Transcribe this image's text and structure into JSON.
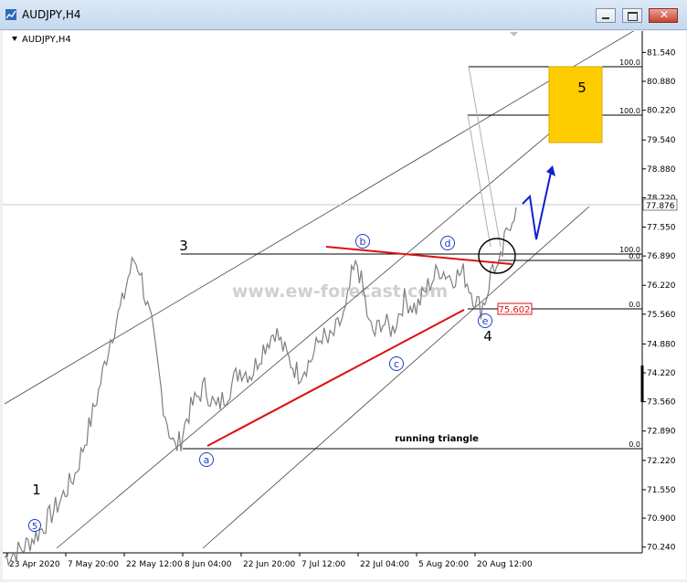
{
  "window": {
    "title": "AUDJPY,H4",
    "buttons": [
      "minimize",
      "restore",
      "close"
    ]
  },
  "chart_label": "AUDJPY,H4",
  "watermark": "www.ew-forecast.com",
  "chart_data": {
    "type": "line",
    "symbol": "AUDJPY",
    "timeframe": "H4",
    "ylim": [
      70.15,
      81.84
    ],
    "y_ticks": [
      "81.540",
      "80.880",
      "80.220",
      "79.540",
      "78.880",
      "78.220",
      "77.550",
      "76.890",
      "76.220",
      "75.560",
      "74.880",
      "74.220",
      "73.560",
      "72.890",
      "72.220",
      "71.550",
      "70.900",
      "70.240"
    ],
    "x_ticks": [
      "23 Apr 2020",
      "7 May 20:00",
      "22 May 12:00",
      "8 Jun 04:00",
      "22 Jun 20:00",
      "7 Jul 12:00",
      "22 Jul 04:00",
      "5 Aug 20:00",
      "20 Aug 12:00"
    ],
    "current_price": "77.876",
    "price_path": [
      [
        0,
        70.0
      ],
      [
        3,
        70.2
      ],
      [
        6,
        70.6
      ],
      [
        9,
        71.2
      ],
      [
        12,
        71.9
      ],
      [
        14,
        72.8
      ],
      [
        16,
        73.8
      ],
      [
        18,
        75.0
      ],
      [
        20,
        75.8
      ],
      [
        21,
        76.4
      ],
      [
        22,
        76.8
      ],
      [
        23,
        76.6
      ],
      [
        24,
        75.9
      ],
      [
        25,
        75.3
      ],
      [
        26,
        74.4
      ],
      [
        27,
        73.5
      ],
      [
        28,
        72.9
      ],
      [
        29,
        72.5
      ],
      [
        30,
        72.7
      ],
      [
        31,
        73.2
      ],
      [
        32,
        73.5
      ],
      [
        34,
        73.9
      ],
      [
        36,
        73.4
      ],
      [
        38,
        73.8
      ],
      [
        40,
        74.3
      ],
      [
        42,
        74.2
      ],
      [
        44,
        74.8
      ],
      [
        46,
        75.2
      ],
      [
        48,
        74.6
      ],
      [
        50,
        74.2
      ],
      [
        52,
        74.5
      ],
      [
        54,
        75.1
      ],
      [
        55,
        74.9
      ],
      [
        56,
        75.1
      ],
      [
        58,
        75.6
      ],
      [
        59,
        76.4
      ],
      [
        60,
        76.7
      ],
      [
        61,
        76.1
      ],
      [
        62,
        75.3
      ],
      [
        63,
        75.1
      ],
      [
        64,
        75.4
      ],
      [
        66,
        75.2
      ],
      [
        68,
        75.9
      ],
      [
        70,
        75.7
      ],
      [
        72,
        76.2
      ],
      [
        74,
        76.6
      ],
      [
        76,
        76.4
      ],
      [
        78,
        76.5
      ],
      [
        80,
        75.9
      ],
      [
        81,
        75.7
      ],
      [
        82,
        76.0
      ],
      [
        83,
        76.7
      ],
      [
        84,
        76.5
      ],
      [
        85,
        77.2
      ],
      [
        86,
        77.7
      ],
      [
        87,
        78.0
      ]
    ],
    "wave_labels": [
      {
        "text": "1",
        "style": "plain"
      },
      {
        "text": "5",
        "style": "circled"
      },
      {
        "text": "3",
        "style": "plain"
      },
      {
        "text": "a",
        "style": "circled"
      },
      {
        "text": "b",
        "style": "circled"
      },
      {
        "text": "c",
        "style": "circled"
      },
      {
        "text": "d",
        "style": "circled"
      },
      {
        "text": "e",
        "style": "circled"
      },
      {
        "text": "4",
        "style": "plain"
      },
      {
        "text": "5",
        "style": "plain"
      }
    ],
    "fib_labels": [
      {
        "text": "100.0",
        "price": 80.88
      },
      {
        "text": "100.0",
        "price": 79.87
      },
      {
        "text": "100.0",
        "price": 76.85
      },
      {
        "text": "0.0",
        "price": 76.75
      },
      {
        "text": "0.0",
        "price": 75.6
      },
      {
        "text": "0.0",
        "price": 72.3
      }
    ],
    "price_box_label": "75.602",
    "annotation": "running triangle",
    "target_zone": {
      "top": 80.88,
      "bottom": 79.25
    },
    "colors": {
      "price": "#7f7f7f",
      "triangle": "#dd1111",
      "projection": "#1020d0",
      "target_zone": "#ffcc00",
      "wave_label": "#1a3ec9"
    }
  }
}
